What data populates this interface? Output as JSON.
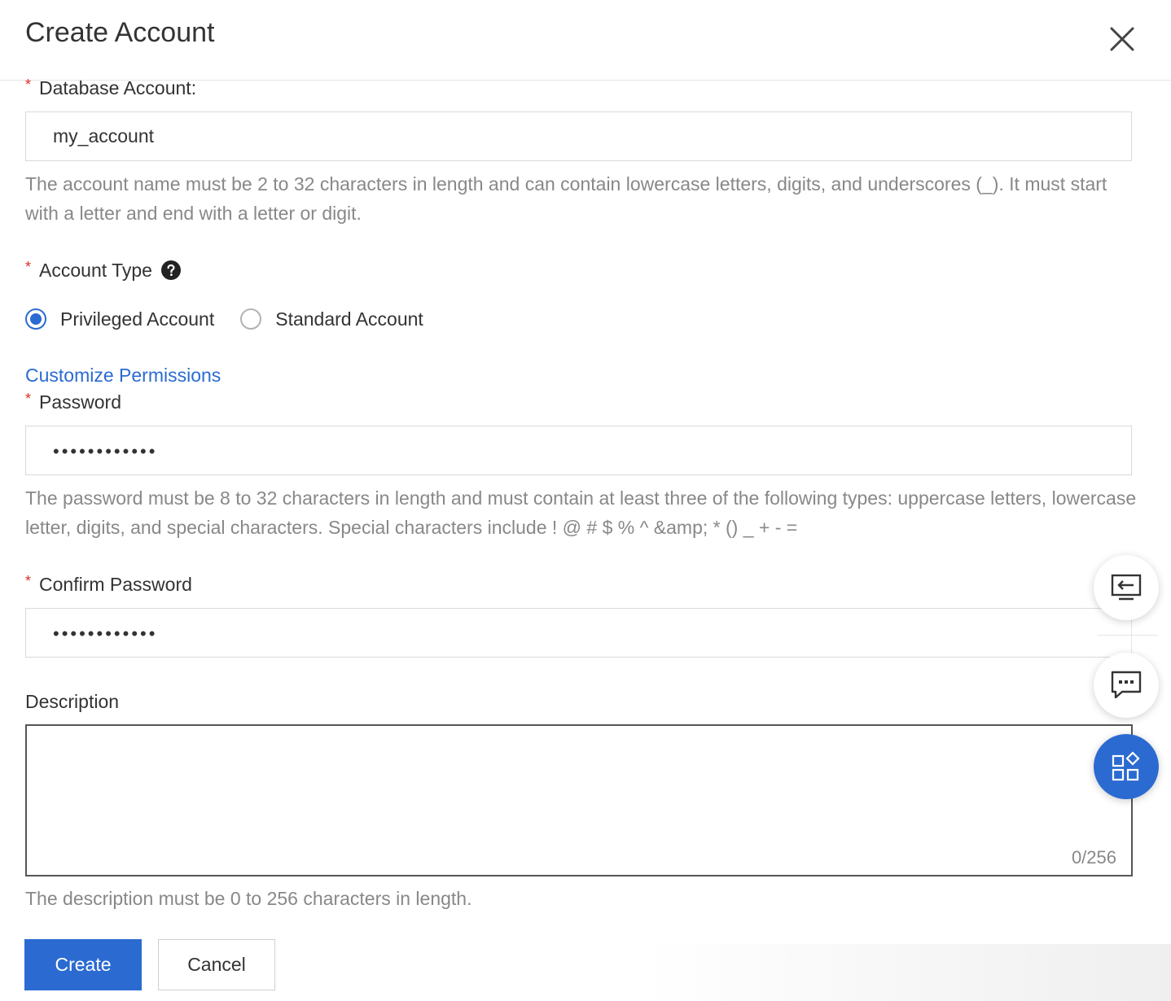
{
  "dialog": {
    "title": "Create Account",
    "close_icon": "close-icon"
  },
  "form": {
    "required_mark": "*",
    "database_account": {
      "label": "Database Account:",
      "value": "my_account",
      "help": "The account name must be 2 to 32 characters in length and can contain lowercase letters, digits, and underscores (_). It must start with a letter and end with a letter or digit."
    },
    "account_type": {
      "label": "Account Type",
      "help_icon": "question-circle-icon",
      "options": [
        {
          "label": "Privileged Account",
          "checked": true
        },
        {
          "label": "Standard Account",
          "checked": false
        }
      ]
    },
    "customize_permissions_link": "Customize Permissions",
    "password": {
      "label": "Password",
      "value": "••••••••••••",
      "help": "The password must be 8 to 32 characters in length and must contain at least three of the following types: uppercase letters, lowercase letter, digits, and special characters. Special characters include ! @ # $ % ^ &amp; * () _ + - ="
    },
    "confirm_password": {
      "label": "Confirm Password",
      "value": "••••••••••••"
    },
    "description": {
      "label": "Description",
      "value": "",
      "counter": "0/256",
      "help": "The description must be 0 to 256 characters in length."
    }
  },
  "buttons": {
    "create": "Create",
    "cancel": "Cancel"
  },
  "floating_toolbar": {
    "items": [
      "collapse-panel-icon",
      "chat-icon",
      "apps-icon"
    ],
    "accent": "#2b6bd1"
  },
  "colors": {
    "accent": "#2b6bd1",
    "required": "#d93026",
    "help_text": "#888888"
  }
}
